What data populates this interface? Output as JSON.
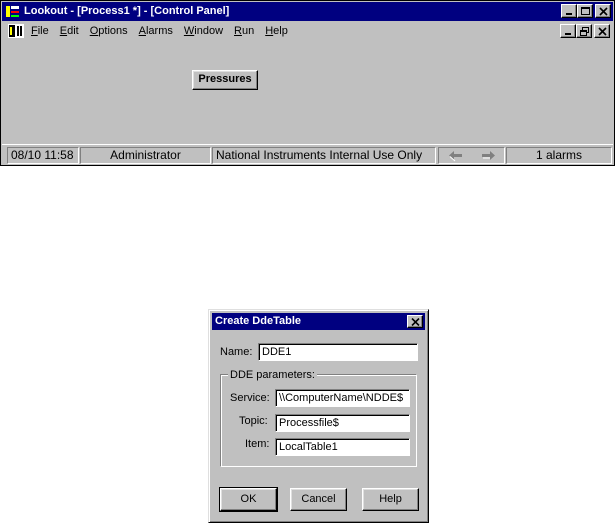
{
  "window": {
    "title": "Lookout - [Process1 *] - [Control Panel]",
    "menu": [
      {
        "label": "File",
        "mnemonic": "F"
      },
      {
        "label": "Edit",
        "mnemonic": "E"
      },
      {
        "label": "Options",
        "mnemonic": "O"
      },
      {
        "label": "Alarms",
        "mnemonic": "A"
      },
      {
        "label": "Window",
        "mnemonic": "W"
      },
      {
        "label": "Run",
        "mnemonic": "R"
      },
      {
        "label": "Help",
        "mnemonic": "H"
      }
    ],
    "panel_button": "Pressures",
    "status": {
      "time": "08/10 11:58",
      "user": "Administrator",
      "message": "National Instruments Internal Use Only",
      "alarms": "1 alarms"
    }
  },
  "dialog": {
    "title": "Create DdeTable",
    "name_label": "Name:",
    "name_value": "DDE1",
    "group_label": "DDE parameters:",
    "service_label": "Service:",
    "service_value": "\\\\ComputerName\\NDDE$",
    "topic_label": "Topic:",
    "topic_value": "Processfile$",
    "item_label": "Item:",
    "item_value": "LocalTable1",
    "ok_label": "OK",
    "cancel_label": "Cancel",
    "help_label": "Help"
  },
  "colors": {
    "titlebar": "#000080",
    "face": "#c0c0c0"
  }
}
